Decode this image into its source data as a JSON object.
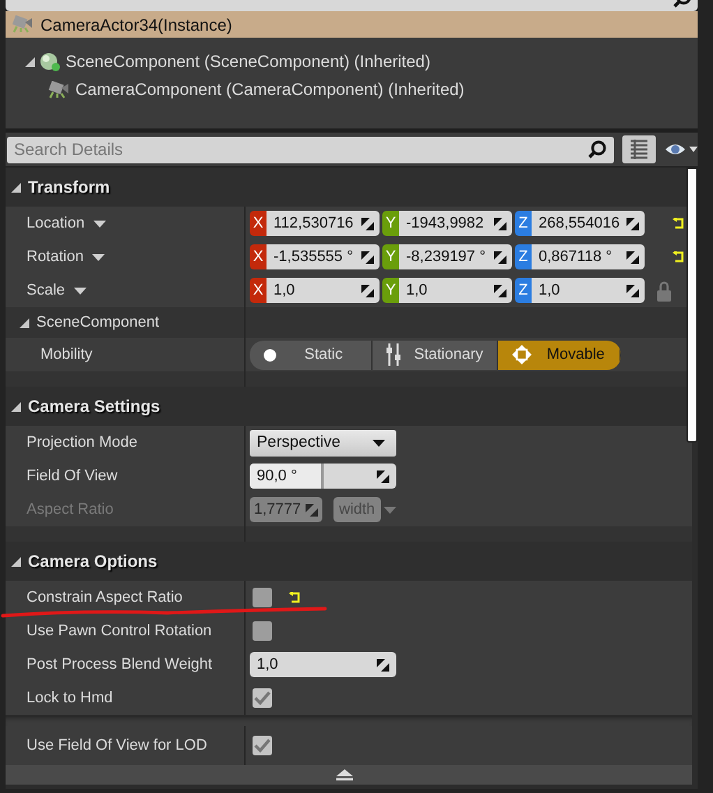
{
  "actor": {
    "label": "CameraActor34(Instance)",
    "selected": true
  },
  "component_tree": [
    {
      "label": "SceneComponent (SceneComponent) (Inherited)",
      "expanded": true,
      "children": [
        {
          "label": "CameraComponent (CameraComponent) (Inherited)"
        }
      ]
    }
  ],
  "details_search": {
    "placeholder": "Search Details"
  },
  "sections": [
    {
      "title": "Transform",
      "expanded": true,
      "rows": [
        {
          "kind": "vector",
          "label": "Location",
          "reset": true,
          "lock": false,
          "components": [
            {
              "axis": "X",
              "value": "112,530716",
              "color": "#c3290b"
            },
            {
              "axis": "Y",
              "value": "-1943,9982",
              "color": "#6a9e0b"
            },
            {
              "axis": "Z",
              "value": "268,554016",
              "color": "#2b7de1"
            }
          ]
        },
        {
          "kind": "vector",
          "label": "Rotation",
          "reset": true,
          "lock": false,
          "components": [
            {
              "axis": "X",
              "value": "-1,535555 °",
              "color": "#c3290b"
            },
            {
              "axis": "Y",
              "value": "-8,239197 °",
              "color": "#6a9e0b"
            },
            {
              "axis": "Z",
              "value": "0,867118 °",
              "color": "#2b7de1"
            }
          ]
        },
        {
          "kind": "vector",
          "label": "Scale",
          "reset": false,
          "lock": true,
          "components": [
            {
              "axis": "X",
              "value": "1,0",
              "color": "#c3290b"
            },
            {
              "axis": "Y",
              "value": "1,0",
              "color": "#6a9e0b"
            },
            {
              "axis": "Z",
              "value": "1,0",
              "color": "#2b7de1"
            }
          ]
        },
        {
          "kind": "category",
          "title": "SceneComponent",
          "expanded": true,
          "rows": [
            {
              "kind": "toggle",
              "label": "Mobility",
              "options": [
                {
                  "label": "Static",
                  "selected": false
                },
                {
                  "label": "Stationary",
                  "selected": false
                },
                {
                  "label": "Movable",
                  "selected": true
                }
              ]
            }
          ]
        }
      ]
    },
    {
      "title": "Camera Settings",
      "expanded": true,
      "rows": [
        {
          "kind": "dropdown",
          "label": "Projection Mode",
          "value": "Perspective"
        },
        {
          "kind": "number",
          "label": "Field Of View",
          "value": "90,0 °",
          "level": 0.5
        },
        {
          "kind": "aspect",
          "label": "Aspect Ratio",
          "value": "1,7777",
          "unit": "width",
          "disabled": true
        }
      ]
    },
    {
      "title": "Camera Options",
      "expanded": true,
      "rows": [
        {
          "kind": "checkbox",
          "label": "Constrain Aspect Ratio",
          "checked": false,
          "reset": true
        },
        {
          "kind": "checkbox",
          "label": "Use Pawn Control Rotation",
          "checked": false,
          "reset": false
        },
        {
          "kind": "number",
          "label": "Post Process Blend Weight",
          "value": "1,0"
        },
        {
          "kind": "checkbox",
          "label": "Lock to Hmd",
          "checked": true,
          "reset": false
        }
      ],
      "advanced_rows": [
        {
          "kind": "checkbox",
          "label": "Use Field Of View for LOD",
          "checked": true,
          "reset": false
        }
      ],
      "advanced_expanded": true
    }
  ],
  "annotation": {
    "kind": "underline"
  }
}
